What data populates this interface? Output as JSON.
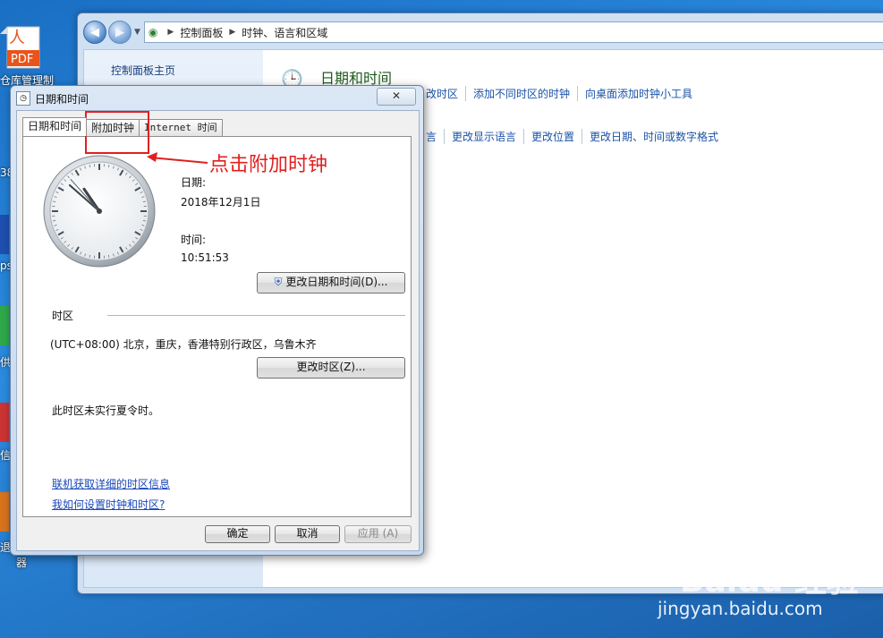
{
  "desktop": {
    "pdf_icon_text": "PDF",
    "labels": [
      "仓库管理制",
      "38",
      "ps",
      "供",
      "信",
      "退",
      "器"
    ]
  },
  "explorer": {
    "breadcrumb": [
      "控制面板",
      "时钟、语言和区域"
    ],
    "left_pane_home": "控制面板主页",
    "category_title": "日期和时间",
    "links_row1": [
      "改时区",
      "添加不同时区的时钟",
      "向桌面添加时钟小工具"
    ],
    "links_row2": [
      "言",
      "更改显示语言",
      "更改位置",
      "更改日期、时间或数字格式"
    ]
  },
  "dialog": {
    "title": "日期和时间",
    "close_label": "✕",
    "tabs": [
      "日期和时间",
      "附加时钟",
      "Internet 时间"
    ],
    "date_label": "日期:",
    "date_value": "2018年12月1日",
    "time_label": "时间:",
    "time_value": "10:51:53",
    "change_datetime_button": "更改日期和时间(D)...",
    "timezone_heading": "时区",
    "timezone_value": "(UTC+08:00) 北京，重庆，香港特别行政区，乌鲁木齐",
    "change_timezone_button": "更改时区(Z)...",
    "dst_note": "此时区未实行夏令时。",
    "link_online_info": "联机获取详细的时区信息",
    "link_how_to": "我如何设置时钟和时区?",
    "ok_button": "确定",
    "cancel_button": "取消",
    "apply_button": "应用 (A)"
  },
  "clock": {
    "hour": 10,
    "minute": 51,
    "second": 53
  },
  "annotation": {
    "text": "点击附加时钟",
    "color": "#e02020"
  },
  "watermark": {
    "brand": "Baidu 经验",
    "url": "jingyan.baidu.com"
  }
}
